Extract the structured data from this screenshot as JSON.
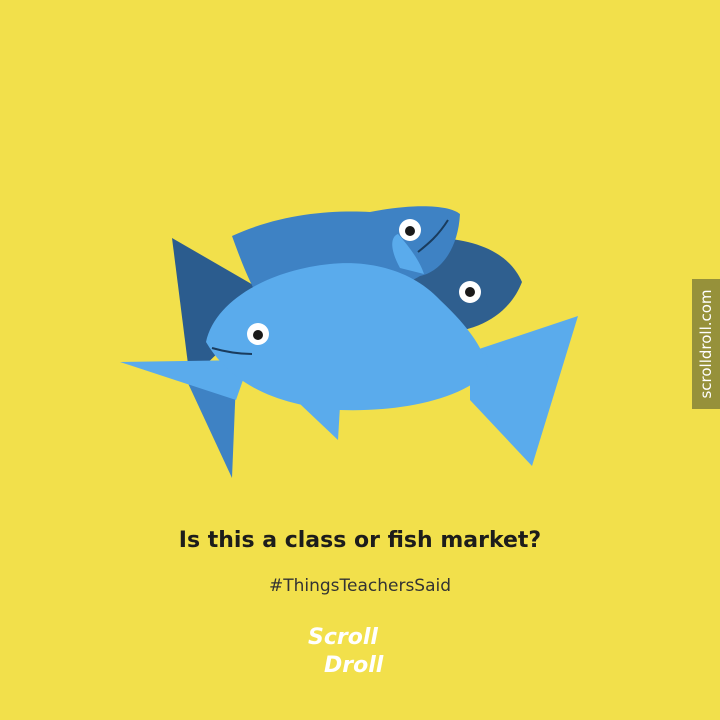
{
  "illustration": {
    "subject": "three cartoon fish",
    "colors": {
      "background": "#f2e04b",
      "fish_back": "#2f5f8f",
      "fish_middle": "#3e82c4",
      "fish_front": "#5aabec",
      "fins_dark": "#2b5c8e"
    }
  },
  "caption": {
    "headline": "Is this a class or fish market?",
    "hashtag": "#ThingsTeachersSaid"
  },
  "side_tab": {
    "text": "scrolldroll.com",
    "color": "#96913a"
  },
  "logo": {
    "line1": "Scroll",
    "line2": "Droll"
  }
}
